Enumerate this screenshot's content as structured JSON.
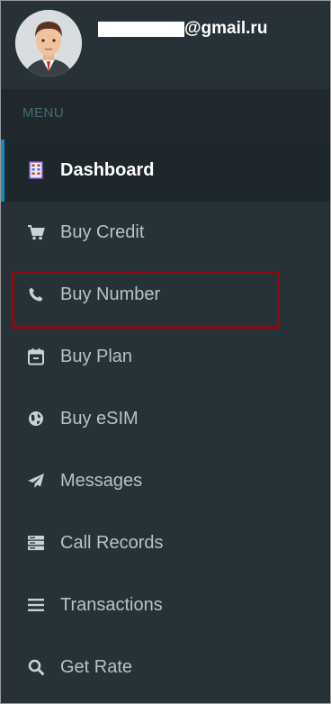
{
  "profile": {
    "email_visible": "@gmail.ru"
  },
  "menu": {
    "section_label": "MENU"
  },
  "nav": {
    "items": [
      {
        "label": "Dashboard",
        "icon": "dashboard-building-icon",
        "active": true
      },
      {
        "label": "Buy Credit",
        "icon": "shopping-cart-icon"
      },
      {
        "label": "Buy Number",
        "icon": "phone-icon"
      },
      {
        "label": "Buy Plan",
        "icon": "calendar-icon"
      },
      {
        "label": "Buy eSIM",
        "icon": "globe-icon"
      },
      {
        "label": "Messages",
        "icon": "paper-plane-icon"
      },
      {
        "label": "Call Records",
        "icon": "server-list-icon"
      },
      {
        "label": "Transactions",
        "icon": "bars-icon"
      },
      {
        "label": "Get Rate",
        "icon": "search-icon"
      }
    ]
  },
  "colors": {
    "sidebar_bg": "#263238",
    "menu_bar_bg": "#20282d",
    "active_indicator": "#1e88b8",
    "highlight_box": "#8e0b0b",
    "label_text": "#b5c3c8"
  }
}
